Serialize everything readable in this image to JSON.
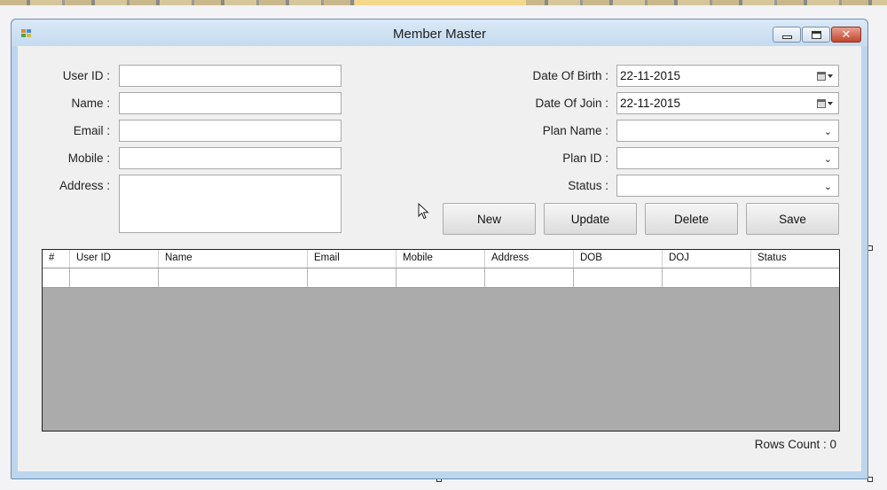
{
  "window": {
    "title": "Member Master"
  },
  "form_left": {
    "user_id_label": "User ID :",
    "name_label": "Name :",
    "email_label": "Email :",
    "mobile_label": "Mobile :",
    "address_label": "Address :",
    "user_id_value": "",
    "name_value": "",
    "email_value": "",
    "mobile_value": "",
    "address_value": ""
  },
  "form_right": {
    "dob_label": "Date Of Birth :",
    "doj_label": "Date Of Join :",
    "plan_name_label": "Plan Name :",
    "plan_id_label": "Plan ID :",
    "status_label": "Status :",
    "dob_value": "22-11-2015",
    "doj_value": "22-11-2015",
    "plan_name_value": "",
    "plan_id_value": "",
    "status_value": ""
  },
  "buttons": {
    "new": "New",
    "update": "Update",
    "delete": "Delete",
    "save": "Save"
  },
  "grid": {
    "columns": [
      "#",
      "User ID",
      "Name",
      "Email",
      "Mobile",
      "Address",
      "DOB",
      "DOJ",
      "Status"
    ]
  },
  "footer": {
    "rows_count": "Rows Count : 0"
  },
  "icons": {
    "calendar": "calendar-icon",
    "dropdown": "chevron-down-icon",
    "cursor": "mouse-pointer-icon"
  },
  "colors": {
    "grid_background": "#ababab",
    "titlebar": "#c4daf0",
    "close_button": "#c4452c"
  }
}
